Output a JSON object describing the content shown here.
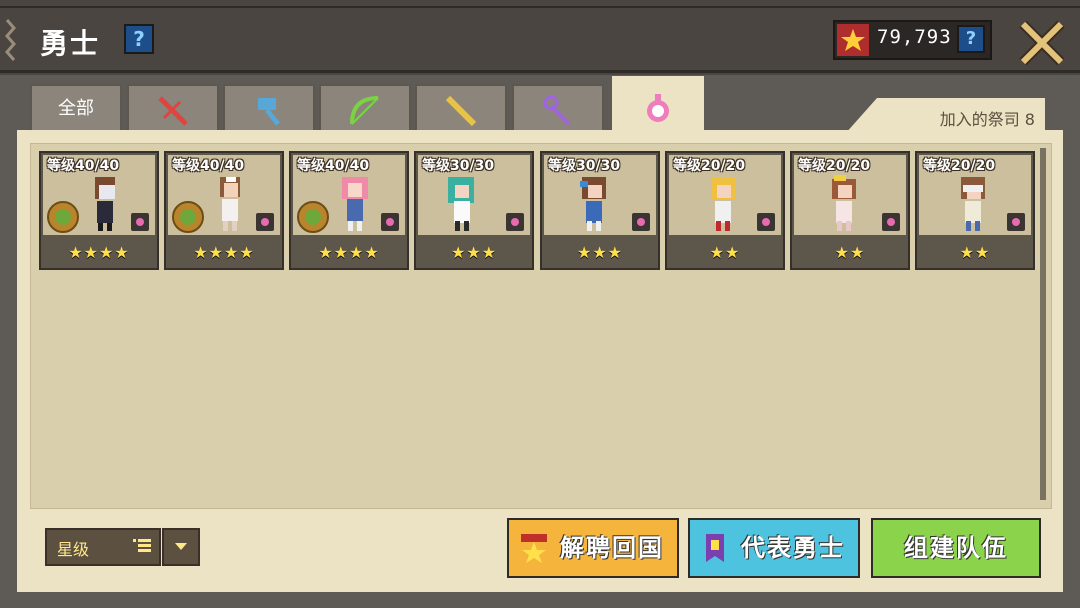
{
  "header": {
    "title": "勇士",
    "currency": "79,793"
  },
  "tabs": [
    {
      "id": "all",
      "label": "全部"
    },
    {
      "id": "warrior",
      "icon": "sword-icon",
      "color": "#e0443f"
    },
    {
      "id": "knight",
      "icon": "hammer-icon",
      "color": "#57a8d8"
    },
    {
      "id": "archer",
      "icon": "bow-icon",
      "color": "#7ad343"
    },
    {
      "id": "hunter",
      "icon": "rifle-icon",
      "color": "#e7c34a"
    },
    {
      "id": "wizard",
      "icon": "staff-icon",
      "color": "#a064e0"
    },
    {
      "id": "priest",
      "icon": "priest-icon",
      "color": "#ef7dbb"
    }
  ],
  "roster": {
    "count_label": "加入的祭司 8"
  },
  "cards": [
    {
      "level": "等级40/40",
      "stars": "★★★★",
      "badge": true
    },
    {
      "level": "等级40/40",
      "stars": "★★★★",
      "badge": true
    },
    {
      "level": "等级40/40",
      "stars": "★★★★",
      "badge": true
    },
    {
      "level": "等级30/30",
      "stars": "★★★",
      "badge": false
    },
    {
      "level": "等级30/30",
      "stars": "★★★",
      "badge": false
    },
    {
      "level": "等级20/20",
      "stars": "★★",
      "badge": false
    },
    {
      "level": "等级20/20",
      "stars": "★★",
      "badge": false
    },
    {
      "level": "等级20/20",
      "stars": "★★",
      "badge": false
    }
  ],
  "footer": {
    "sort_label": "星级",
    "dismiss_label": "解聘回国",
    "representative_label": "代表勇士",
    "team_label": "组建队伍"
  },
  "colors": {
    "dismiss": "#f5b43c",
    "representative": "#4ec3e0",
    "team": "#8bd34a"
  }
}
